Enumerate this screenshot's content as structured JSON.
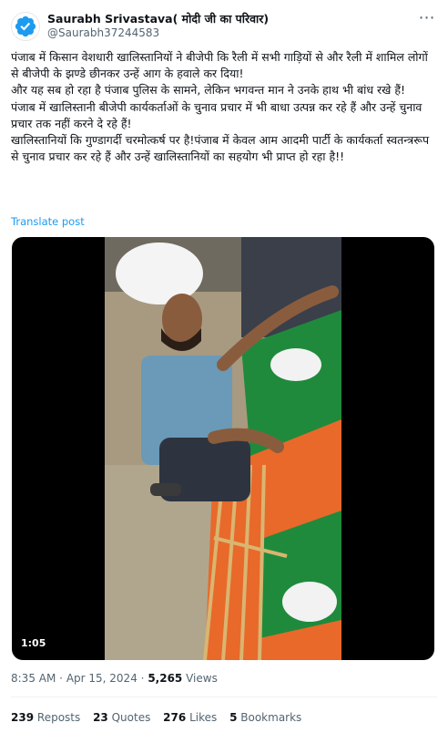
{
  "author": {
    "name": "Saurabh Srivastava( मोदी जी का परिवार)",
    "handle": "@Saurabh37244583",
    "avatar_icon": "verified-badge-icon"
  },
  "tweet": {
    "text": "पंजाब में किसान वेशधारी खालिस्तानियों ने बीजेपी कि रैली में सभी गाड़ियों से और रैली में शामिल लोगों से बीजेपी के झण्डे छीनकर उन्हें आग के हवाले कर दिया!\nऔर यह सब हो रहा है पंजाब पुलिस के सामने, लेकिन भगवन्त मान ने उनके हाथ भी बांध रखे हैं!\nपंजाब में खालिस्तानी बीजेपी कार्यकर्ताओं के चुनाव प्रचार में भी बाधा उत्पन्न कर रहे हैं और उन्हें चुनाव प्रचार तक नहीं करने दे रहे हैं!\nखालिस्तानियों कि गुण्डागर्दी चरमोत्कर्ष पर है!पंजाब में केवल आम आदमी पार्टी के कार्यकर्ता स्वतन्त्ररूप से चुनाव प्रचार कर रहे हैं और उन्हें खालिस्तानियों का सहयोग भी प्राप्त हो रहा है!!",
    "translate_label": "Translate post"
  },
  "video": {
    "duration": "1:05"
  },
  "meta": {
    "time": "8:35 AM",
    "separator": "·",
    "date": "Apr 15, 2024",
    "views_count": "5,265",
    "views_label": "Views"
  },
  "stats": {
    "reposts_count": "239",
    "reposts_label": "Reposts",
    "quotes_count": "23",
    "quotes_label": "Quotes",
    "likes_count": "276",
    "likes_label": "Likes",
    "bookmarks_count": "5",
    "bookmarks_label": "Bookmarks"
  },
  "colors": {
    "accent": "#1d9bf0",
    "text": "#0f1419",
    "secondary": "#536471",
    "saffron": "#f26522",
    "flag_green": "#1a8a3a"
  }
}
